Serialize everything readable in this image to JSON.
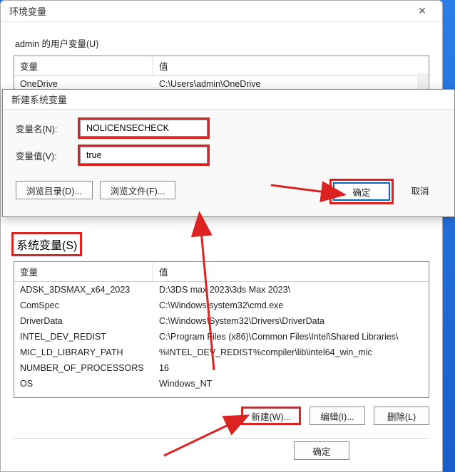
{
  "env_window": {
    "title": "环境变量",
    "user_section_label": "admin 的用户变量(U)",
    "sys_section_label": "系统变量(S)",
    "col_var": "变量",
    "col_val": "值",
    "user_rows": [
      {
        "var": "OneDrive",
        "val": "C:\\Users\\admin\\OneDrive"
      }
    ],
    "sys_rows": [
      {
        "var": "ADSK_3DSMAX_x64_2023",
        "val": "D:\\3DS max 2023\\3ds Max 2023\\"
      },
      {
        "var": "ComSpec",
        "val": "C:\\Windows\\system32\\cmd.exe"
      },
      {
        "var": "DriverData",
        "val": "C:\\Windows\\System32\\Drivers\\DriverData"
      },
      {
        "var": "INTEL_DEV_REDIST",
        "val": "C:\\Program Files (x86)\\Common Files\\Intel\\Shared Libraries\\"
      },
      {
        "var": "MIC_LD_LIBRARY_PATH",
        "val": "%INTEL_DEV_REDIST%compiler\\lib\\intel64_win_mic"
      },
      {
        "var": "NUMBER_OF_PROCESSORS",
        "val": "16"
      },
      {
        "var": "OS",
        "val": "Windows_NT"
      }
    ],
    "btn_new": "新建(W)...",
    "btn_edit": "编辑(I)...",
    "btn_delete": "删除(L)",
    "btn_ok": "确定"
  },
  "modal": {
    "title": "新建系统变量",
    "name_label": "变量名(N):",
    "name_value": "NOLICENSECHECK",
    "value_label": "变量值(V):",
    "value_value": "true",
    "btn_browse_dir": "浏览目录(D)...",
    "btn_browse_file": "浏览文件(F)...",
    "btn_ok": "确定",
    "btn_cancel": "取消"
  }
}
